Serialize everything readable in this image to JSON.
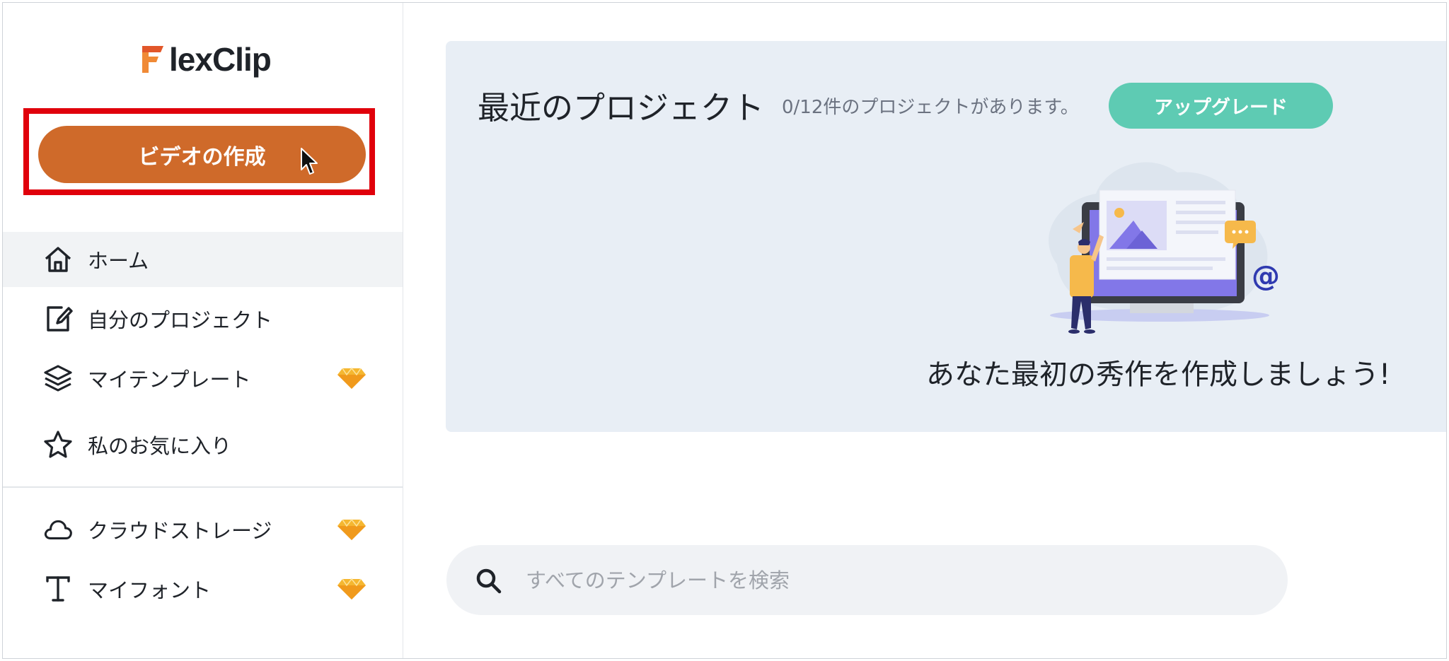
{
  "brand": {
    "name": "lexClip",
    "logo_letter": "F",
    "accent": "#cf6a2a"
  },
  "sidebar": {
    "create_button": "ビデオの作成",
    "items": [
      {
        "label": "ホーム",
        "icon": "home-icon",
        "premium": false,
        "active": true
      },
      {
        "label": "自分のプロジェクト",
        "icon": "edit-icon",
        "premium": false,
        "active": false
      },
      {
        "label": "マイテンプレート",
        "icon": "layers-icon",
        "premium": true,
        "active": false
      },
      {
        "label": "私のお気に入り",
        "icon": "star-icon",
        "premium": false,
        "active": false
      },
      {
        "label": "クラウドストレージ",
        "icon": "cloud-icon",
        "premium": true,
        "active": false
      },
      {
        "label": "マイフォント",
        "icon": "text-icon",
        "premium": true,
        "active": false
      }
    ]
  },
  "recent": {
    "title": "最近のプロジェクト",
    "count_text": "0/12件のプロジェクトがあります。",
    "upgrade_button": "アップグレード",
    "empty_message": "あなた最初の秀作を作成しましょう!"
  },
  "search": {
    "placeholder": "すべてのテンプレートを検索",
    "value": ""
  },
  "colors": {
    "create_button": "#cf6a2a",
    "upgrade_button": "#5ecbb3",
    "panel_bg": "#e8eef5",
    "highlight": "#e0000b",
    "premium_gem": "#f5b731"
  }
}
